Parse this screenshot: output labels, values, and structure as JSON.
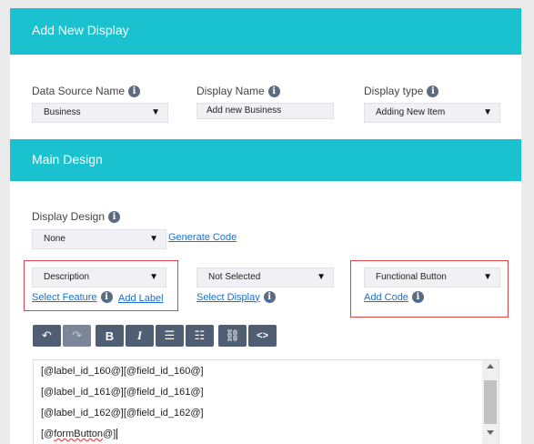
{
  "header": {
    "title": "Add New Display"
  },
  "form": {
    "data_source": {
      "label": "Data Source Name",
      "value": "Business"
    },
    "display_name": {
      "label": "Display Name",
      "value": "Add new Business"
    },
    "display_type": {
      "label": "Display type",
      "value": "Adding New Item"
    }
  },
  "main_design": {
    "title": "Main Design",
    "display_design": {
      "label": "Display Design",
      "value": "None",
      "generate_link": "Generate Code"
    },
    "feature_select": {
      "value": "Description",
      "select_link": "Select Feature",
      "add_link": "Add Label"
    },
    "display_select": {
      "value": "Not Selected",
      "select_link": "Select Display"
    },
    "button_select": {
      "value": "Functional Button",
      "add_link": "Add Code"
    }
  },
  "toolbar": {
    "buttons": [
      {
        "name": "undo",
        "glyph": "↶"
      },
      {
        "name": "redo",
        "glyph": "↷"
      },
      {
        "name": "bold",
        "glyph": "B"
      },
      {
        "name": "italic",
        "glyph": "I"
      },
      {
        "name": "bullet-list",
        "glyph": "☰"
      },
      {
        "name": "numbered-list",
        "glyph": "☷"
      },
      {
        "name": "link",
        "glyph": "⛓"
      },
      {
        "name": "code",
        "glyph": "<>"
      }
    ]
  },
  "editor": {
    "lines": [
      "[@label_id_160@][@field_id_160@]",
      "[@label_id_161@][@field_id_161@]",
      "[@label_id_162@][@field_id_162@]"
    ],
    "last_line_prefix": "[@",
    "last_line_word": "formButton",
    "last_line_suffix": "@]"
  }
}
